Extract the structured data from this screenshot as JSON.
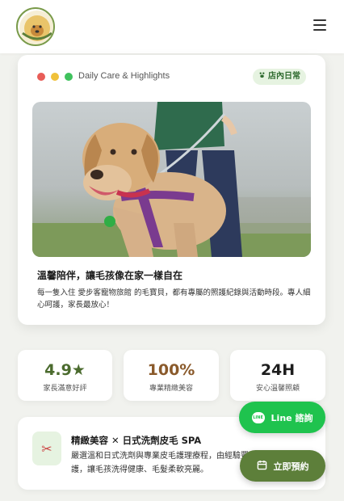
{
  "header": {
    "logo_icon": "dog-paw-badge-logo",
    "menu_icon": "hamburger-menu-icon"
  },
  "hero": {
    "window_dots": [
      "#e85d58",
      "#f0c13a",
      "#3fc25d"
    ],
    "caption": "Daily Care & Highlights",
    "tag": "店內日常",
    "tag_icon": "paw-icon",
    "photo": "dog-on-leash-photo",
    "title": "溫馨陪伴，讓毛孩像在家一樣自在",
    "description": "每一隻入住 愛步客寵物旅館 的毛寶貝，都有專屬的照護紀錄與活動時段。專人細心呵護，家長最放心！"
  },
  "stats": [
    {
      "value": "4.9★",
      "label": "家長滿意好評",
      "color": "#4b6b2e"
    },
    {
      "value": "100%",
      "label": "專業精緻美容",
      "color": "#8a5a2b"
    },
    {
      "value": "24H",
      "label": "安心溫馨照顧",
      "color": "#1d1d1d"
    }
  ],
  "service": {
    "icon": "scissors-icon",
    "title": "精緻美容 ✕ 日式洗劑皮毛 SPA",
    "description": "嚴選溫和日式洗劑與專業皮毛護理療程，由經驗豐富美容師細心洗護，讓毛孩洗得健康、毛髮柔軟亮麗。"
  },
  "buttons": {
    "line_label": "Line 諮詢",
    "line_icon": "line-chat-icon",
    "book_label": "立即預約",
    "book_icon": "calendar-icon"
  }
}
